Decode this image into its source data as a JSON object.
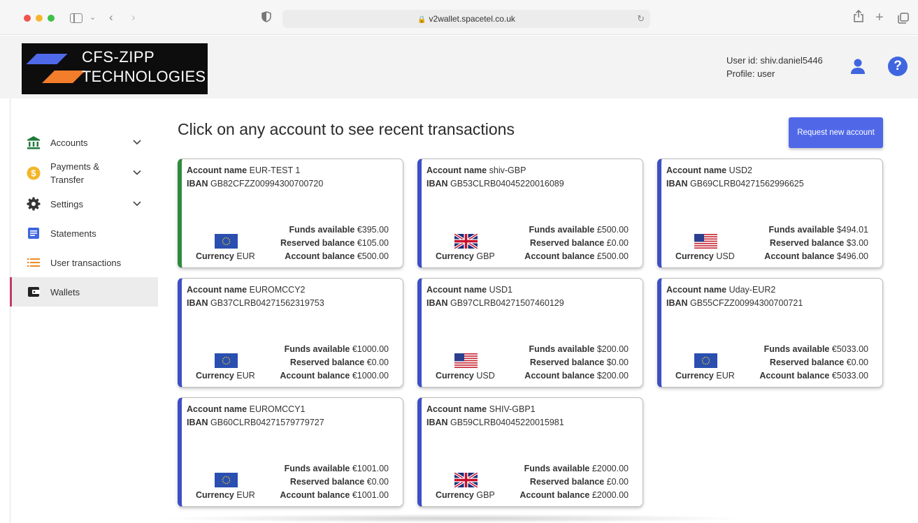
{
  "browser": {
    "url": "v2wallet.spacetel.co.uk"
  },
  "logo": {
    "line1": "CFS-ZIPP",
    "line2": "TECHNOLOGIES"
  },
  "user": {
    "user_id_text": "User id: shiv.daniel5446",
    "profile_text": "Profile: user"
  },
  "sidebar": {
    "items": [
      {
        "label": "Accounts",
        "icon": "bank-icon"
      },
      {
        "label_line1": "Payments &",
        "label_line2": "Transfer",
        "icon": "dollar-coin-icon"
      },
      {
        "label": "Settings",
        "icon": "gear-icon"
      },
      {
        "label": "Statements",
        "icon": "document-icon"
      },
      {
        "label": "User transactions",
        "icon": "list-icon"
      },
      {
        "label": "Wallets",
        "icon": "wallet-icon"
      }
    ]
  },
  "main": {
    "title": "Click on any account to see recent transactions",
    "request_button": "Request new account"
  },
  "labels": {
    "account_name": "Account name",
    "iban": "IBAN",
    "funds_available": "Funds available",
    "reserved_balance": "Reserved balance",
    "account_balance": "Account balance",
    "currency": "Currency"
  },
  "accounts": [
    {
      "name": "EUR-TEST 1",
      "iban": "GB82CFZZ00994300700720",
      "currency": "EUR",
      "funds": "€395.00",
      "reserved": "€105.00",
      "balance": "€500.00",
      "flag": "eu-flag-icon"
    },
    {
      "name": "shiv-GBP",
      "iban": "GB53CLRB04045220016089",
      "currency": "GBP",
      "funds": "£500.00",
      "reserved": "£0.00",
      "balance": "£500.00",
      "flag": "uk-flag-icon"
    },
    {
      "name": "USD2",
      "iban": "GB69CLRB04271562996625",
      "currency": "USD",
      "funds": "$494.01",
      "reserved": "$3.00",
      "balance": "$496.00",
      "flag": "us-flag-icon"
    },
    {
      "name": "EUROMCCY2",
      "iban": "GB37CLRB04271562319753",
      "currency": "EUR",
      "funds": "€1000.00",
      "reserved": "€0.00",
      "balance": "€1000.00",
      "flag": "eu-flag-icon"
    },
    {
      "name": "USD1",
      "iban": "GB97CLRB04271507460129",
      "currency": "USD",
      "funds": "$200.00",
      "reserved": "$0.00",
      "balance": "$200.00",
      "flag": "us-flag-icon"
    },
    {
      "name": "Uday-EUR2",
      "iban": "GB55CFZZ00994300700721",
      "currency": "EUR",
      "funds": "€5033.00",
      "reserved": "€0.00",
      "balance": "€5033.00",
      "flag": "eu-flag-icon"
    },
    {
      "name": "EUROMCCY1",
      "iban": "GB60CLRB04271579779727",
      "currency": "EUR",
      "funds": "€1001.00",
      "reserved": "€0.00",
      "balance": "€1001.00",
      "flag": "eu-flag-icon"
    },
    {
      "name": "SHIV-GBP1",
      "iban": "GB59CLRB04045220015981",
      "currency": "GBP",
      "funds": "£2000.00",
      "reserved": "£0.00",
      "balance": "£2000.00",
      "flag": "uk-flag-icon"
    }
  ],
  "colors": {
    "accent": "#5068e8",
    "card_border_default": "#3e4fc4",
    "card_border_selected": "#2f8a3e",
    "nav_active_marker": "#c23a6b",
    "icon_green": "#1f7a3a",
    "icon_yellow": "#f2b62a",
    "icon_blue": "#3f66e0",
    "icon_orange": "#f08a24"
  }
}
